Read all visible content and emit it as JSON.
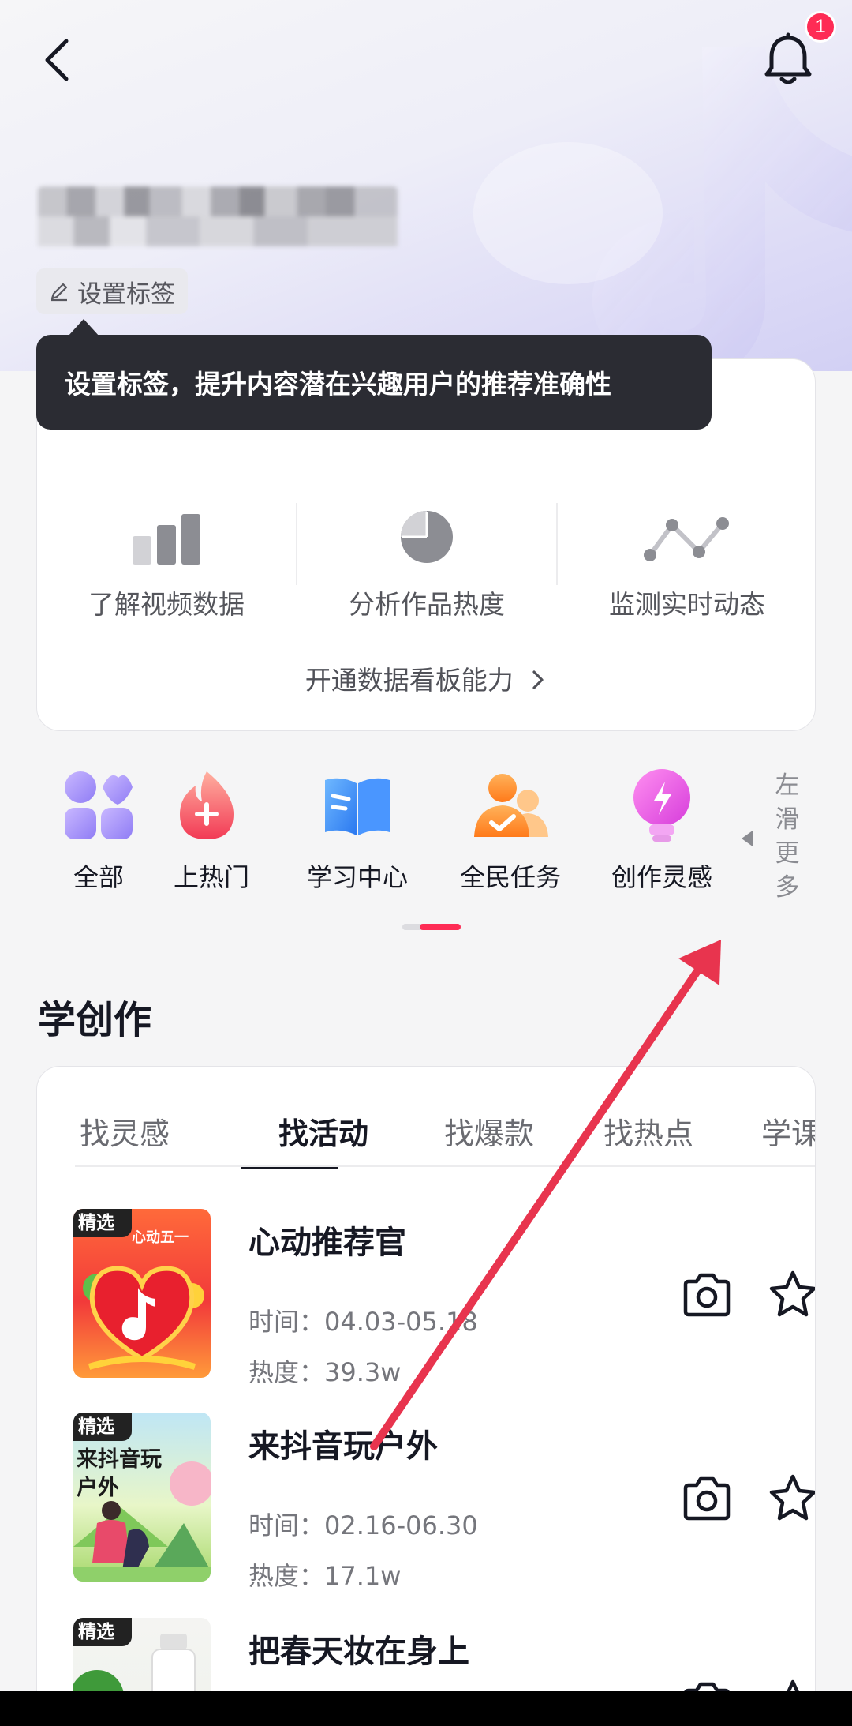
{
  "header": {
    "notification_count": "1"
  },
  "profile": {
    "tag_button_label": "设置标签"
  },
  "tooltip": {
    "text": "设置标签，提升内容潜在兴趣用户的推荐准确性"
  },
  "data_card": {
    "features": [
      {
        "label": "了解视频数据",
        "icon": "bar-chart-icon"
      },
      {
        "label": "分析作品热度",
        "icon": "pie-chart-icon"
      },
      {
        "label": "监测实时动态",
        "icon": "line-chart-icon"
      }
    ],
    "open_link": "开通数据看板能力"
  },
  "shortcuts": {
    "items": [
      {
        "label": "全部",
        "icon": "grid-icon"
      },
      {
        "label": "上热门",
        "icon": "flame-icon"
      },
      {
        "label": "学习中心",
        "icon": "book-icon"
      },
      {
        "label": "全民任务",
        "icon": "people-check-icon"
      },
      {
        "label": "创作灵感",
        "icon": "lightbulb-icon"
      }
    ],
    "more_hint": "左滑更多"
  },
  "learn": {
    "title": "学创作",
    "tabs": [
      "找灵感",
      "找活动",
      "找爆款",
      "找热点",
      "学课程"
    ],
    "active_tab": 1,
    "activities": [
      {
        "badge": "精选",
        "title": "心动推荐官",
        "time": "时间：04.03-05.18",
        "heat": "热度：39.3w",
        "thumb_text": "心动五一"
      },
      {
        "badge": "精选",
        "title": "来抖音玩户外",
        "time": "时间：02.16-06.30",
        "heat": "热度：17.1w",
        "thumb_text": "来抖音玩户外"
      },
      {
        "badge": "精选",
        "title": "把春天妆在身上",
        "time": "",
        "heat": ""
      }
    ]
  },
  "colors": {
    "accent": "#fe2c55",
    "annotation_arrow": "#e8344e",
    "tooltip_bg": "#2b2c33"
  }
}
